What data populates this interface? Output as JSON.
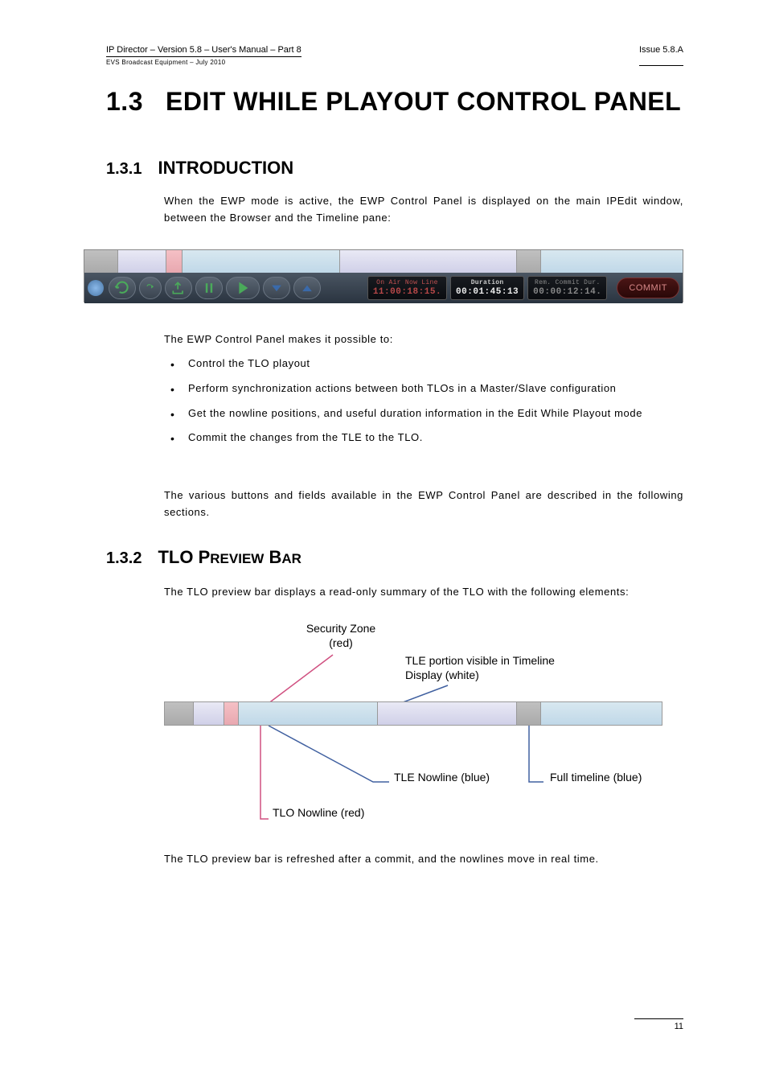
{
  "header": {
    "left": "IP Director – Version 5.8 – User's Manual – Part 8",
    "sub": "EVS Broadcast Equipment – July 2010",
    "right": "Issue 5.8.A"
  },
  "section": {
    "num": "1.3",
    "title": "EDIT WHILE PLAYOUT CONTROL PANEL"
  },
  "sub1": {
    "num": "1.3.1",
    "title": "INTRODUCTION"
  },
  "intro": "When the EWP mode is active, the EWP Control Panel is displayed on the main IPEdit window, between the Browser and the Timeline pane:",
  "ewp": {
    "onair_label": "On Air Now Line",
    "onair_value": "11:00:18:15.",
    "duration_label": "Duration",
    "duration_value": "00:01:45:13",
    "rem_label": "Rem. Commit Dur.",
    "rem_value": "00:00:12:14.",
    "commit": "COMMIT"
  },
  "para2": "The EWP Control Panel makes it possible to:",
  "bullets": [
    "Control the TLO playout",
    "Perform synchronization actions between both TLOs in a Master/Slave configuration",
    "Get the nowline positions, and useful duration information in the Edit While Playout mode",
    "Commit the changes from the TLE to the TLO."
  ],
  "para3": "The various buttons and fields available in the EWP Control Panel are described in the following sections.",
  "sub2": {
    "num": "1.3.2",
    "title_1": "TLO P",
    "title_2": "REVIEW",
    "title_3": " B",
    "title_4": "AR"
  },
  "para4": "The TLO preview bar displays a read-only summary of the TLO with the following elements:",
  "diagram": {
    "security": "Security Zone (red)",
    "tle_visible": "TLE portion visible in Timeline Display (white)",
    "tle_nowline": "TLE Nowline (blue)",
    "full_timeline": "Full timeline (blue)",
    "tlo_nowline": "TLO Nowline (red)"
  },
  "para5": "The TLO preview bar is refreshed after a commit, and the nowlines move in real time.",
  "footer": "11"
}
